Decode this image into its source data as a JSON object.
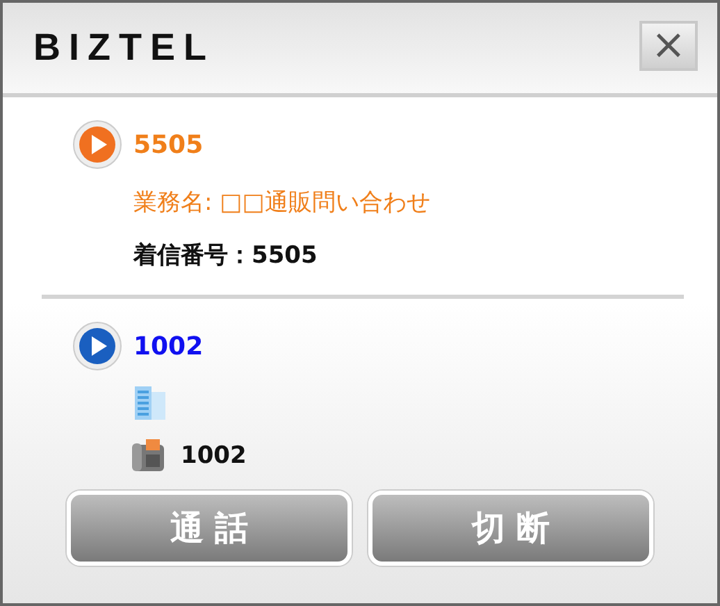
{
  "window": {
    "title": "BIZTEL",
    "close": "×"
  },
  "calls": [
    {
      "number": "5505",
      "color": "#f07020",
      "lines": [
        {
          "kind": "service",
          "text": "業務名: □□通販問い合わせ"
        },
        {
          "kind": "incoming",
          "text": "着信番号：5505"
        }
      ]
    },
    {
      "number": "1002",
      "color": "#1a5fc0",
      "lines": [
        {
          "kind": "building"
        },
        {
          "kind": "phone",
          "text": "1002"
        }
      ]
    }
  ],
  "buttons": [
    "通 話",
    "切 断"
  ]
}
